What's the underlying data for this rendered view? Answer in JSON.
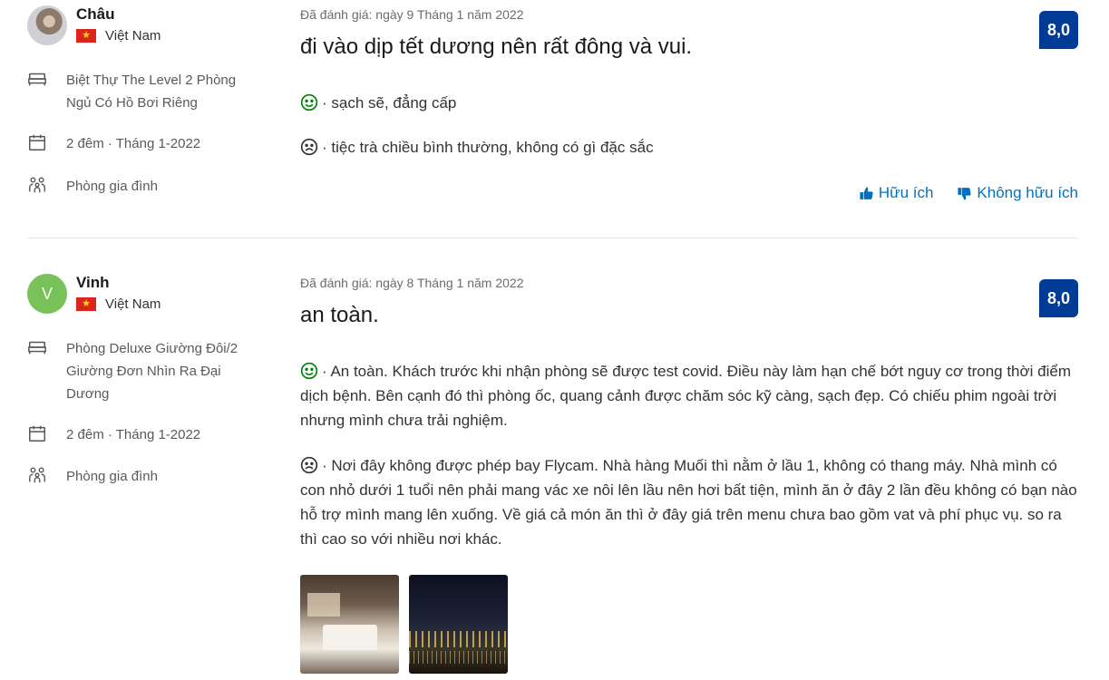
{
  "reviews": [
    {
      "reviewer_name": "Châu",
      "country": "Việt Nam",
      "room": "Biệt Thự The Level 2 Phòng Ngủ Có Hồ Bơi Riêng",
      "stay": "2 đêm · Tháng 1-2022",
      "traveler_type": "Phòng gia đình",
      "review_date": "Đã đánh giá: ngày 9 Tháng 1 năm 2022",
      "title": "đi vào dịp tết dương nên rất đông và vui.",
      "score": "8,0",
      "positive": "· sạch sẽ, đẳng cấp",
      "negative": "· tiệc trà chiều bình thường, không có gì đặc sắc",
      "helpful_label": "Hữu ích",
      "not_helpful_label": "Không hữu ích"
    },
    {
      "reviewer_name": "Vinh",
      "avatar_letter": "V",
      "country": "Việt Nam",
      "room": "Phòng Deluxe Giường Đôi/2 Giường Đơn Nhìn Ra Đại Dương",
      "stay": "2 đêm · Tháng 1-2022",
      "traveler_type": "Phòng gia đình",
      "review_date": "Đã đánh giá: ngày 8 Tháng 1 năm 2022",
      "title": "an toàn.",
      "score": "8,0",
      "positive": "· An toàn. Khách trước khi nhận phòng sẽ được test covid. Điều này làm hạn chế bớt nguy cơ trong thời điểm dịch bệnh. Bên cạnh đó thì phòng ốc, quang cảnh được chăm sóc kỹ càng, sạch đẹp. Có chiếu phim ngoài trời nhưng mình chưa trải nghiệm.",
      "negative": "· Nơi đây không được phép bay Flycam. Nhà hàng Muối thì nằm ở lầu 1, không có thang máy. Nhà mình có con nhỏ dưới 1 tuổi nên phải mang vác xe nôi lên lầu nên hơi bất tiện, mình ăn ở đây 2 lần đều không có bạn nào hỗ trợ mình mang lên xuống. Về giá cả món ăn thì ở đây giá trên menu chưa bao gồm vat và phí phục vụ. so ra thì cao so với nhiều nơi khác."
    }
  ],
  "colors": {
    "score_bg": "#003b95",
    "link": "#0071c2",
    "positive_icon": "#008009"
  },
  "icons": [
    "bed-icon",
    "calendar-icon",
    "family-icon",
    "smile-icon",
    "frown-icon",
    "thumbs-up-icon",
    "thumbs-down-icon"
  ]
}
